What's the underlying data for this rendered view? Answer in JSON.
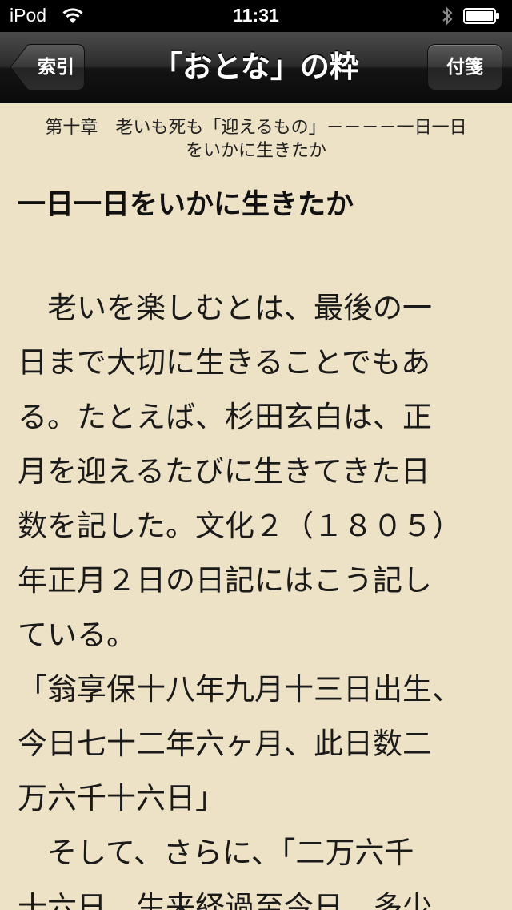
{
  "status_bar": {
    "carrier": "iPod",
    "time": "11:31"
  },
  "nav": {
    "back_label": "索引",
    "title": "「おとな」の粋",
    "bookmark_label": "付箋"
  },
  "chapter": {
    "line1": "第十章　老いも死も「迎えるもの」－－－－一日一日",
    "line2": "をいかに生きたか"
  },
  "section_title": "一日一日をいかに生きたか",
  "body_lines": [
    "　老いを楽しむとは、最後の一",
    "日まで大切に生きることでもあ",
    "る。たとえば、杉田玄白は、正",
    "月を迎えるたびに生きてきた日",
    "数を記した。文化２（１８０５）",
    "年正月２日の日記にはこう記し",
    "ている。",
    "「翁享保十八年九月十三日出生、",
    "今日七十二年六ヶ月、此日数二",
    "万六千十六日」",
    "　そして、さらに、「二万六千",
    "十六日、生来経過至今日、多少"
  ],
  "colors": {
    "page_background": "#ede2c6",
    "status_bar": "#000000",
    "nav_bar": "#1c1c1c",
    "text": "#1a1a1a"
  },
  "icons": [
    "wifi-icon",
    "bluetooth-icon",
    "battery-icon",
    "back-arrow-icon"
  ]
}
